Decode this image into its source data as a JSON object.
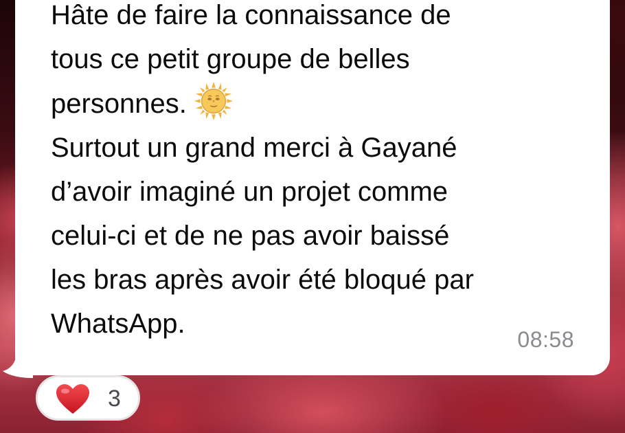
{
  "message": {
    "lines": [
      "Hâte de faire la connaissance de",
      "tous ce petit groupe de belles",
      "personnes."
    ],
    "emoji": "sun-with-face-icon",
    "lines_after": [
      "Surtout un grand merci à Gayané",
      "d’avoir imaginé un projet comme",
      "celui-ci et de ne pas avoir baissé",
      "les bras après avoir été bloqué par",
      "WhatsApp."
    ],
    "time": "08:58"
  },
  "reaction": {
    "icon": "red-heart-icon",
    "count": "3"
  },
  "colors": {
    "bubble": "#ffffff",
    "text": "#0b0b0b",
    "timestamp": "#8a8a8f",
    "heart": "#e0242e"
  }
}
